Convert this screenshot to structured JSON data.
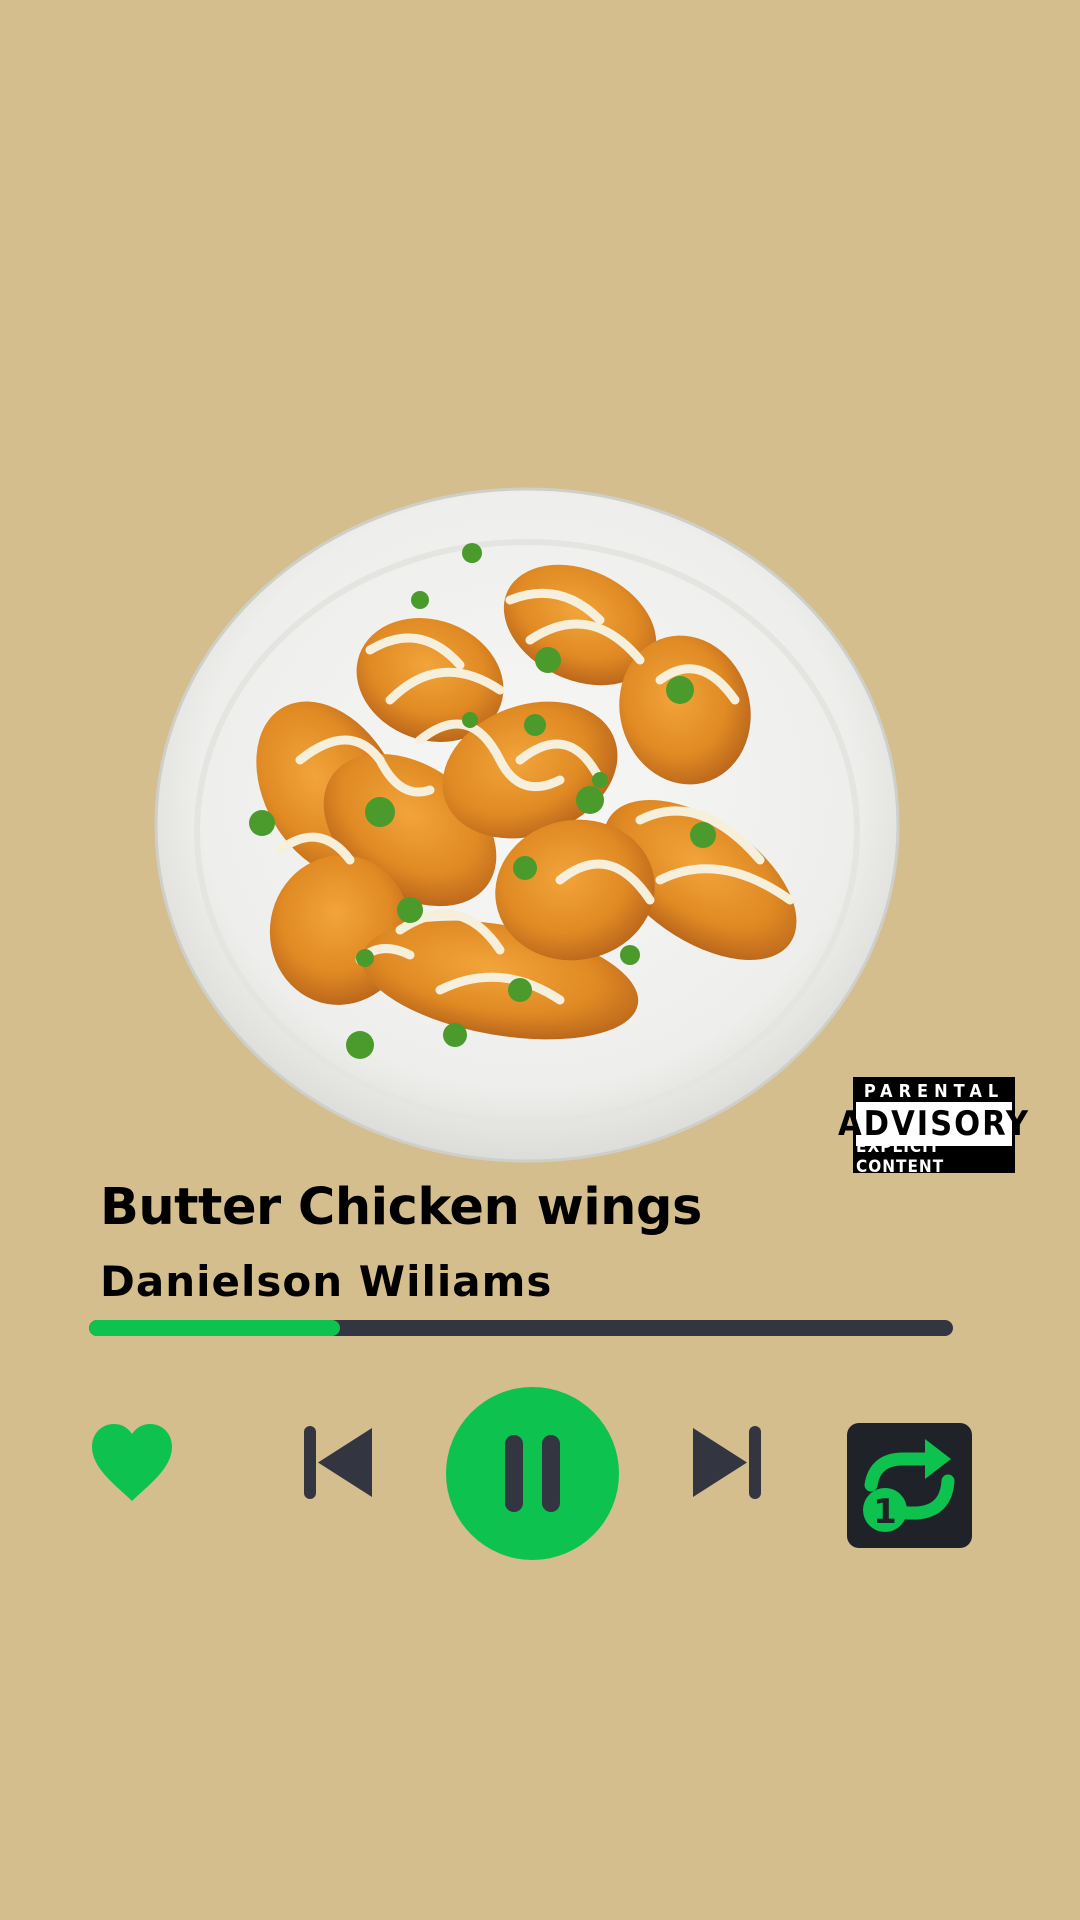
{
  "track": {
    "title": "Butter Chicken wings",
    "artist": "Danielson Wiliams"
  },
  "advisory": {
    "line1": "PARENTAL",
    "line2": "ADVISORY",
    "line3": "EXPLICIT CONTENT"
  },
  "playback": {
    "progress_fraction": 0.29,
    "state": "playing",
    "liked": true,
    "repeat_mode": "repeat-one",
    "repeat_badge": "1"
  },
  "colors": {
    "background": "#d4be8e",
    "accent": "#0dc24f",
    "dark": "#333641"
  },
  "icons": {
    "like": "heart-icon",
    "previous": "skip-previous-icon",
    "play_pause": "pause-icon",
    "next": "skip-next-icon",
    "repeat": "repeat-one-icon"
  }
}
